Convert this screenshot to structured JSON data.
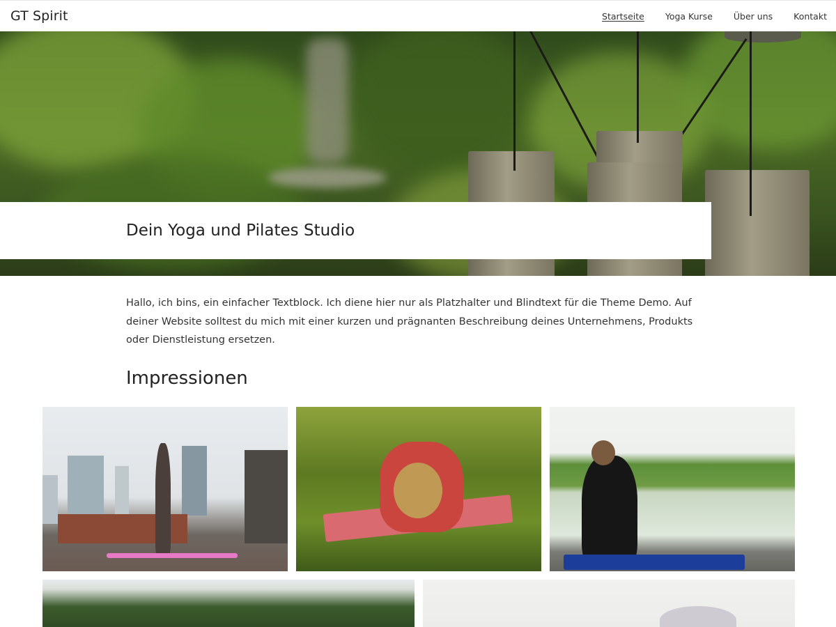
{
  "header": {
    "site_title": "GT Spirit",
    "nav": [
      {
        "label": "Startseite",
        "active": true
      },
      {
        "label": "Yoga Kurse",
        "active": false
      },
      {
        "label": "Über uns",
        "active": false
      },
      {
        "label": "Kontakt",
        "active": false
      }
    ]
  },
  "hero": {
    "title": "Dein Yoga und Pilates Studio"
  },
  "intro": {
    "text": "Hallo, ich bins, ein einfacher Textblock. Ich diene hier nur als Platzhalter und Blindtext für die Theme Demo. Auf deiner Website solltest du mich mit einer kurzen und prägnanten Beschreibung deines Unternehmens, Produkts oder Dienstleistung ersetzen."
  },
  "gallery": {
    "title": "Impressionen",
    "images": [
      {
        "subject": "yoga-tree-pose-rooftop"
      },
      {
        "subject": "yoga-childs-pose-grass"
      },
      {
        "subject": "yoga-seated-twist-lake"
      },
      {
        "subject": "landscape-trees"
      },
      {
        "subject": "person-white-background"
      }
    ]
  },
  "colors": {
    "background": "#ffffff",
    "text": "#333333",
    "heading": "#222222"
  }
}
